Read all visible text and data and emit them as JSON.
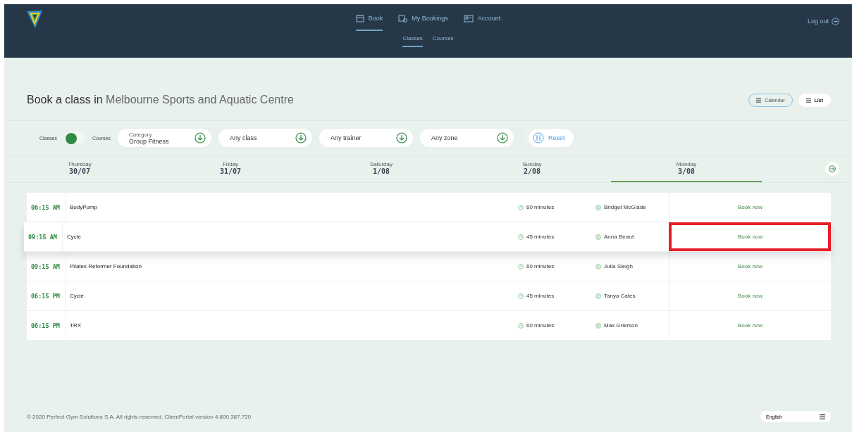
{
  "nav": {
    "items": [
      {
        "label": "Book",
        "selected": true
      },
      {
        "label": "My Bookings",
        "selected": false
      },
      {
        "label": "Account",
        "selected": false
      }
    ],
    "subnav": [
      {
        "label": "Classes",
        "selected": true
      },
      {
        "label": "Courses",
        "selected": false
      }
    ],
    "logout": "Log out"
  },
  "title": {
    "lead": "Book a class in",
    "place": "Melbourne Sports and Aquatic Centre"
  },
  "views": [
    {
      "label": "Calendar",
      "selected": false
    },
    {
      "label": "List",
      "selected": true
    }
  ],
  "mode": {
    "left": "Classes",
    "right": "Courses",
    "on": false
  },
  "filters": [
    {
      "caption": "Category",
      "value": "Group Fitness"
    },
    {
      "value": "Any class"
    },
    {
      "value": "Any trainer"
    },
    {
      "value": "Any zone"
    }
  ],
  "reset": "Reset",
  "days": [
    {
      "weekday": "Thursday",
      "date": "30/07",
      "selected": false
    },
    {
      "weekday": "Friday",
      "date": "31/07",
      "selected": false
    },
    {
      "weekday": "Saturday",
      "date": "1/08",
      "selected": false
    },
    {
      "weekday": "Sunday",
      "date": "2/08",
      "selected": false
    },
    {
      "weekday": "Monday",
      "date": "3/08",
      "selected": true
    }
  ],
  "classes": [
    {
      "time": "06:15 AM",
      "name": "BodyPump",
      "duration": "60 minutes",
      "trainer": "Bridget McGlade",
      "action": "Book now",
      "highlighted": false,
      "annotated": false
    },
    {
      "time": "09:15 AM",
      "name": "Cycle",
      "duration": "45 minutes",
      "trainer": "Anna Bearzi",
      "action": "Book now",
      "highlighted": true,
      "annotated": true
    },
    {
      "time": "09:15 AM",
      "name": "Pilates Reformer Foundation",
      "duration": "60 minutes",
      "trainer": "Julia Sleigh",
      "action": "Book now",
      "highlighted": false,
      "annotated": false
    },
    {
      "time": "06:15 PM",
      "name": "Cycle",
      "duration": "45 minutes",
      "trainer": "Tanya Cates",
      "action": "Book now",
      "highlighted": false,
      "annotated": false
    },
    {
      "time": "06:15 PM",
      "name": "TRX",
      "duration": "60 minutes",
      "trainer": "Max Grierson",
      "action": "Book now",
      "highlighted": false,
      "annotated": false
    }
  ],
  "footer": {
    "copyright": "© 2020 Perfect Gym Solutions S.A. All rights reserved. ClientPortal version 4.800.387.720",
    "language": "English"
  }
}
